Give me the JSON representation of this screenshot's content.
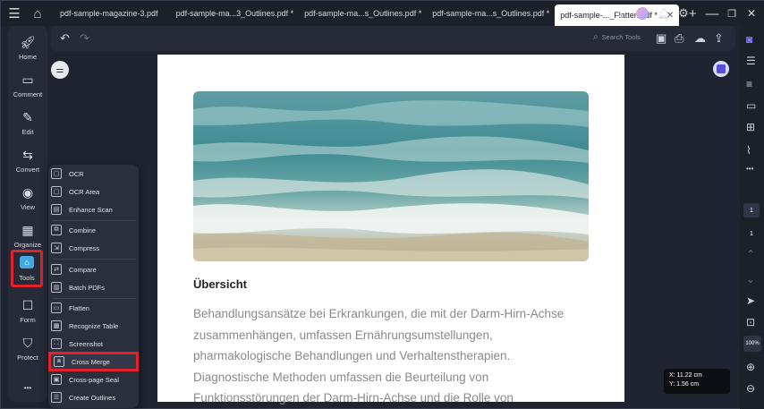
{
  "tabbar": {
    "tabs": [
      {
        "label": "pdf-sample-magazine-3.pdf"
      },
      {
        "label": "pdf-sample-ma...3_Outlines.pdf *"
      },
      {
        "label": "pdf-sample-ma...s_Outlines.pdf *"
      },
      {
        "label": "pdf-sample-ma...s_Outlines.pdf *"
      },
      {
        "label": "pdf-sample-..._Flatten.pdf *"
      }
    ],
    "close_glyph": "✕",
    "add_glyph": "+"
  },
  "leftnav": {
    "items": [
      {
        "label": "Home",
        "icon": "rocket-icon"
      },
      {
        "label": "Comment",
        "icon": "comment-icon"
      },
      {
        "label": "Edit",
        "icon": "edit-icon"
      },
      {
        "label": "Convert",
        "icon": "convert-icon"
      },
      {
        "label": "View",
        "icon": "eye-icon"
      },
      {
        "label": "Organize",
        "icon": "organize-icon"
      },
      {
        "label": "Tools",
        "icon": "tools-icon"
      },
      {
        "label": "Form",
        "icon": "form-icon"
      },
      {
        "label": "Protect",
        "icon": "shield-icon"
      }
    ],
    "more_glyph": "•••"
  },
  "toolbar": {
    "search_placeholder": "Search Tools"
  },
  "tools_menu": {
    "items": [
      {
        "label": "OCR"
      },
      {
        "label": "OCR Area"
      },
      {
        "label": "Enhance Scan"
      },
      {
        "label": "Combine"
      },
      {
        "label": "Compress"
      },
      {
        "label": "Compare"
      },
      {
        "label": "Batch PDFs"
      },
      {
        "label": "Flatten"
      },
      {
        "label": "Recognize Table"
      },
      {
        "label": "Screenshot"
      },
      {
        "label": "Cross Merge"
      },
      {
        "label": "Cross-page Seal"
      },
      {
        "label": "Create Outlines"
      }
    ],
    "highlighted": "Cross Merge"
  },
  "document": {
    "heading": "Übersicht",
    "lines": [
      "Behandlungsansätze bei Erkrankungen, die mit der Darm-Hirn-Achse",
      "zusammenhängen, umfassen Ernährungsumstellungen,",
      "pharmakologische Behandlungen und Verhaltenstherapien.",
      "Diagnostische Methoden umfassen die Beurteilung von",
      "Funktionsstörungen der Darm-Hirn-Achse und die Rolle von"
    ]
  },
  "status": {
    "x": "X: 11.22 cm",
    "y": "Y: 1.56 cm"
  },
  "rightrail": {
    "current_page": "1",
    "total_pages": "1",
    "zoom": "100%"
  },
  "colors": {
    "highlight": "#e2212a",
    "accent": "#46a8e0",
    "ai": "#5a4de0"
  }
}
